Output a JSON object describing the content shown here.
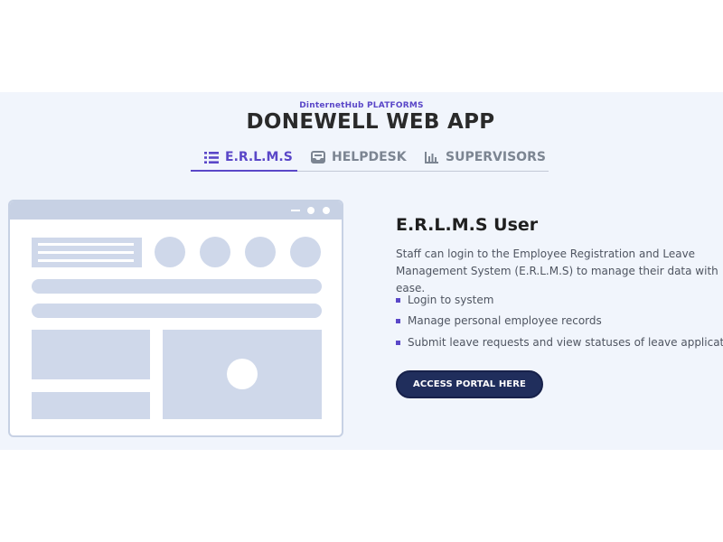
{
  "header": {
    "eyebrow": "DinternetHub PLATFORMS",
    "title": "DONEWELL WEB APP"
  },
  "tabs": [
    {
      "label": "E.R.L.M.S",
      "icon": "list-icon",
      "active": true
    },
    {
      "label": "HELPDESK",
      "icon": "inbox-icon",
      "active": false
    },
    {
      "label": "SUPERVISORS",
      "icon": "bar-chart-icon",
      "active": false
    }
  ],
  "panel": {
    "title": "E.R.L.M.S User",
    "description": "Staff can login to the Employee Registration and Leave Management System (E.R.L.M.S) to manage their data with ease.",
    "features": [
      "Login to system",
      "Manage personal employee records",
      "Submit leave requests and view statuses of leave applications"
    ],
    "cta_label": "ACCESS PORTAL HERE"
  },
  "colors": {
    "accent": "#5a47c8",
    "cta_bg": "#202e5c",
    "section_bg": "#f1f5fc",
    "mockup_fill": "#cfd8ea"
  }
}
